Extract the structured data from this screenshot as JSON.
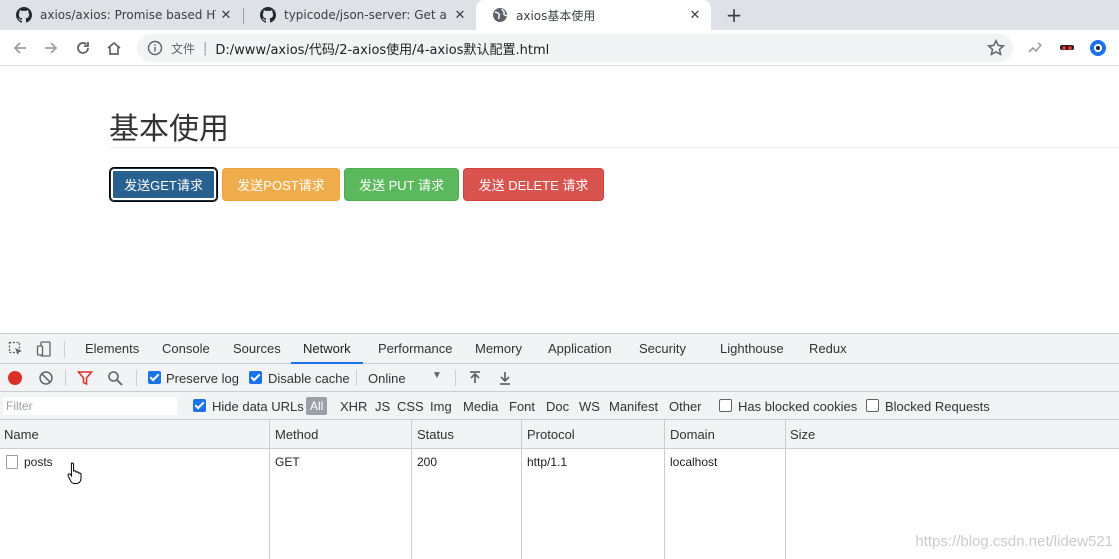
{
  "browser": {
    "tabs": [
      {
        "title": "axios/axios: Promise based HT",
        "icon": "github-icon"
      },
      {
        "title": "typicode/json-server: Get a ful",
        "icon": "github-icon"
      },
      {
        "title": "axios基本使用",
        "icon": "globe-icon",
        "active": true
      }
    ],
    "omnibox": {
      "label": "文件",
      "url": "D:/www/axios/代码/2-axios使用/4-axios默认配置.html"
    }
  },
  "page": {
    "title": "基本使用",
    "buttons": {
      "get": "发送GET请求",
      "post": "发送POST请求",
      "put": "发送 PUT 请求",
      "delete": "发送 DELETE 请求"
    }
  },
  "devtools": {
    "tabs": [
      "Elements",
      "Console",
      "Sources",
      "Network",
      "Performance",
      "Memory",
      "Application",
      "Security",
      "Lighthouse",
      "Redux"
    ],
    "active_tab": "Network",
    "toolbar": {
      "preserve_log": "Preserve log",
      "disable_cache": "Disable cache",
      "throttle": "Online"
    },
    "filterbar": {
      "placeholder": "Filter",
      "hide_data_urls": "Hide data URLs",
      "types": [
        "All",
        "XHR",
        "JS",
        "CSS",
        "Img",
        "Media",
        "Font",
        "Doc",
        "WS",
        "Manifest",
        "Other"
      ],
      "has_blocked_cookies": "Has blocked cookies",
      "blocked_requests": "Blocked Requests"
    },
    "table": {
      "columns": [
        "Name",
        "Method",
        "Status",
        "Protocol",
        "Domain",
        "Size"
      ],
      "rows": [
        {
          "name": "posts",
          "method": "GET",
          "status": "200",
          "protocol": "http/1.1",
          "domain": "localhost",
          "size": ""
        }
      ]
    }
  },
  "watermark": "https://blog.csdn.net/lidew521"
}
